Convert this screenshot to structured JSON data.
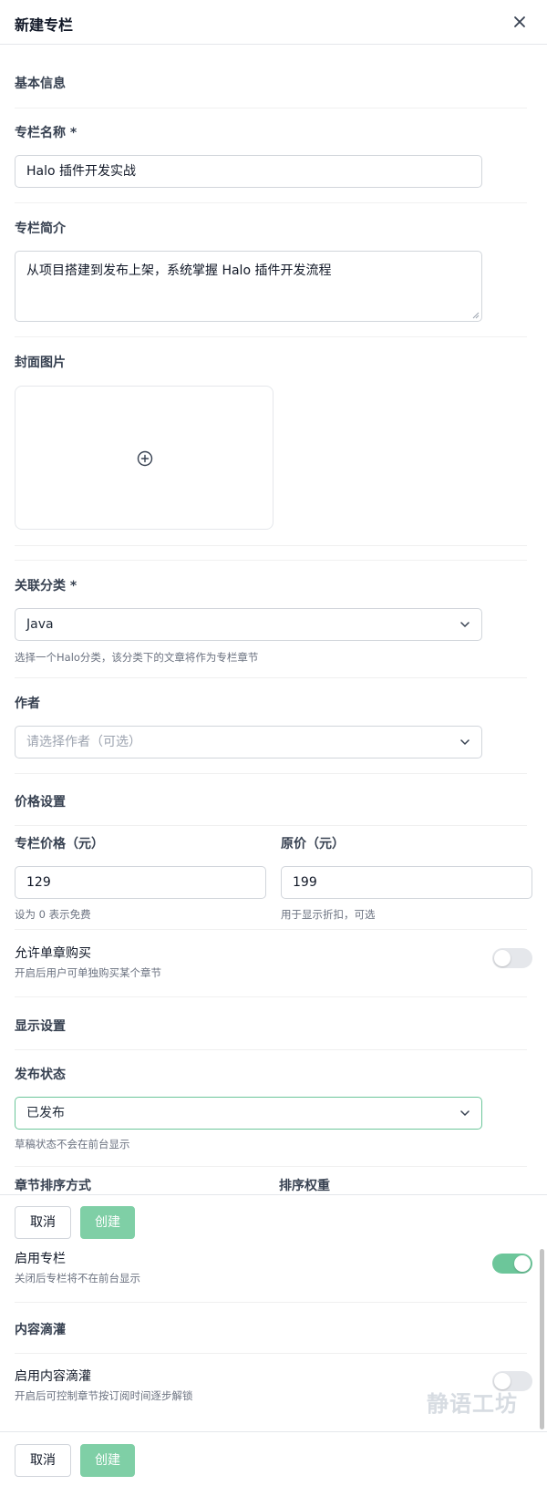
{
  "dialog": {
    "title": "新建专栏",
    "close_icon": "close-icon"
  },
  "basic": {
    "section_title": "基本信息",
    "name_label": "专栏名称 *",
    "name_value": "Halo 插件开发实战",
    "intro_label": "专栏简介",
    "intro_value": "从项目搭建到发布上架，系统掌握 Halo 插件开发流程",
    "cover_label": "封面图片",
    "cover_icon": "plus-circle-icon",
    "category_label": "关联分类 *",
    "category_value": "Java",
    "category_hint": "选择一个Halo分类，该分类下的文章将作为专栏章节",
    "author_label": "作者",
    "author_placeholder": "请选择作者（可选）"
  },
  "price": {
    "section_title": "价格设置",
    "price_label": "专栏价格（元）",
    "price_value": "129",
    "price_hint": "设为 0 表示免费",
    "original_label": "原价（元）",
    "original_value": "199",
    "original_hint": "用于显示折扣，可选",
    "single_label": "允许单章购买",
    "single_hint": "开启后用户可单独购买某个章节",
    "single_enabled": false
  },
  "display": {
    "section_title": "显示设置",
    "status_label": "发布状态",
    "status_value": "已发布",
    "status_hint": "草稿状态不会在前台显示",
    "sort_label": "章节排序方式",
    "weight_label": "排序权重",
    "enable_label": "启用专栏",
    "enable_hint": "关闭后专栏将不在前台显示",
    "enable_on": true
  },
  "drip": {
    "section_title": "内容滴灌",
    "enable_label": "启用内容滴灌",
    "enable_hint": "开启后可控制章节按订阅时间逐步解锁",
    "enable_on": false
  },
  "footer": {
    "cancel_label": "取消",
    "create_label": "创建"
  },
  "watermark": "静语工坊",
  "colors": {
    "accent": "#6cc69a",
    "create_button": "#7fcfa6"
  }
}
